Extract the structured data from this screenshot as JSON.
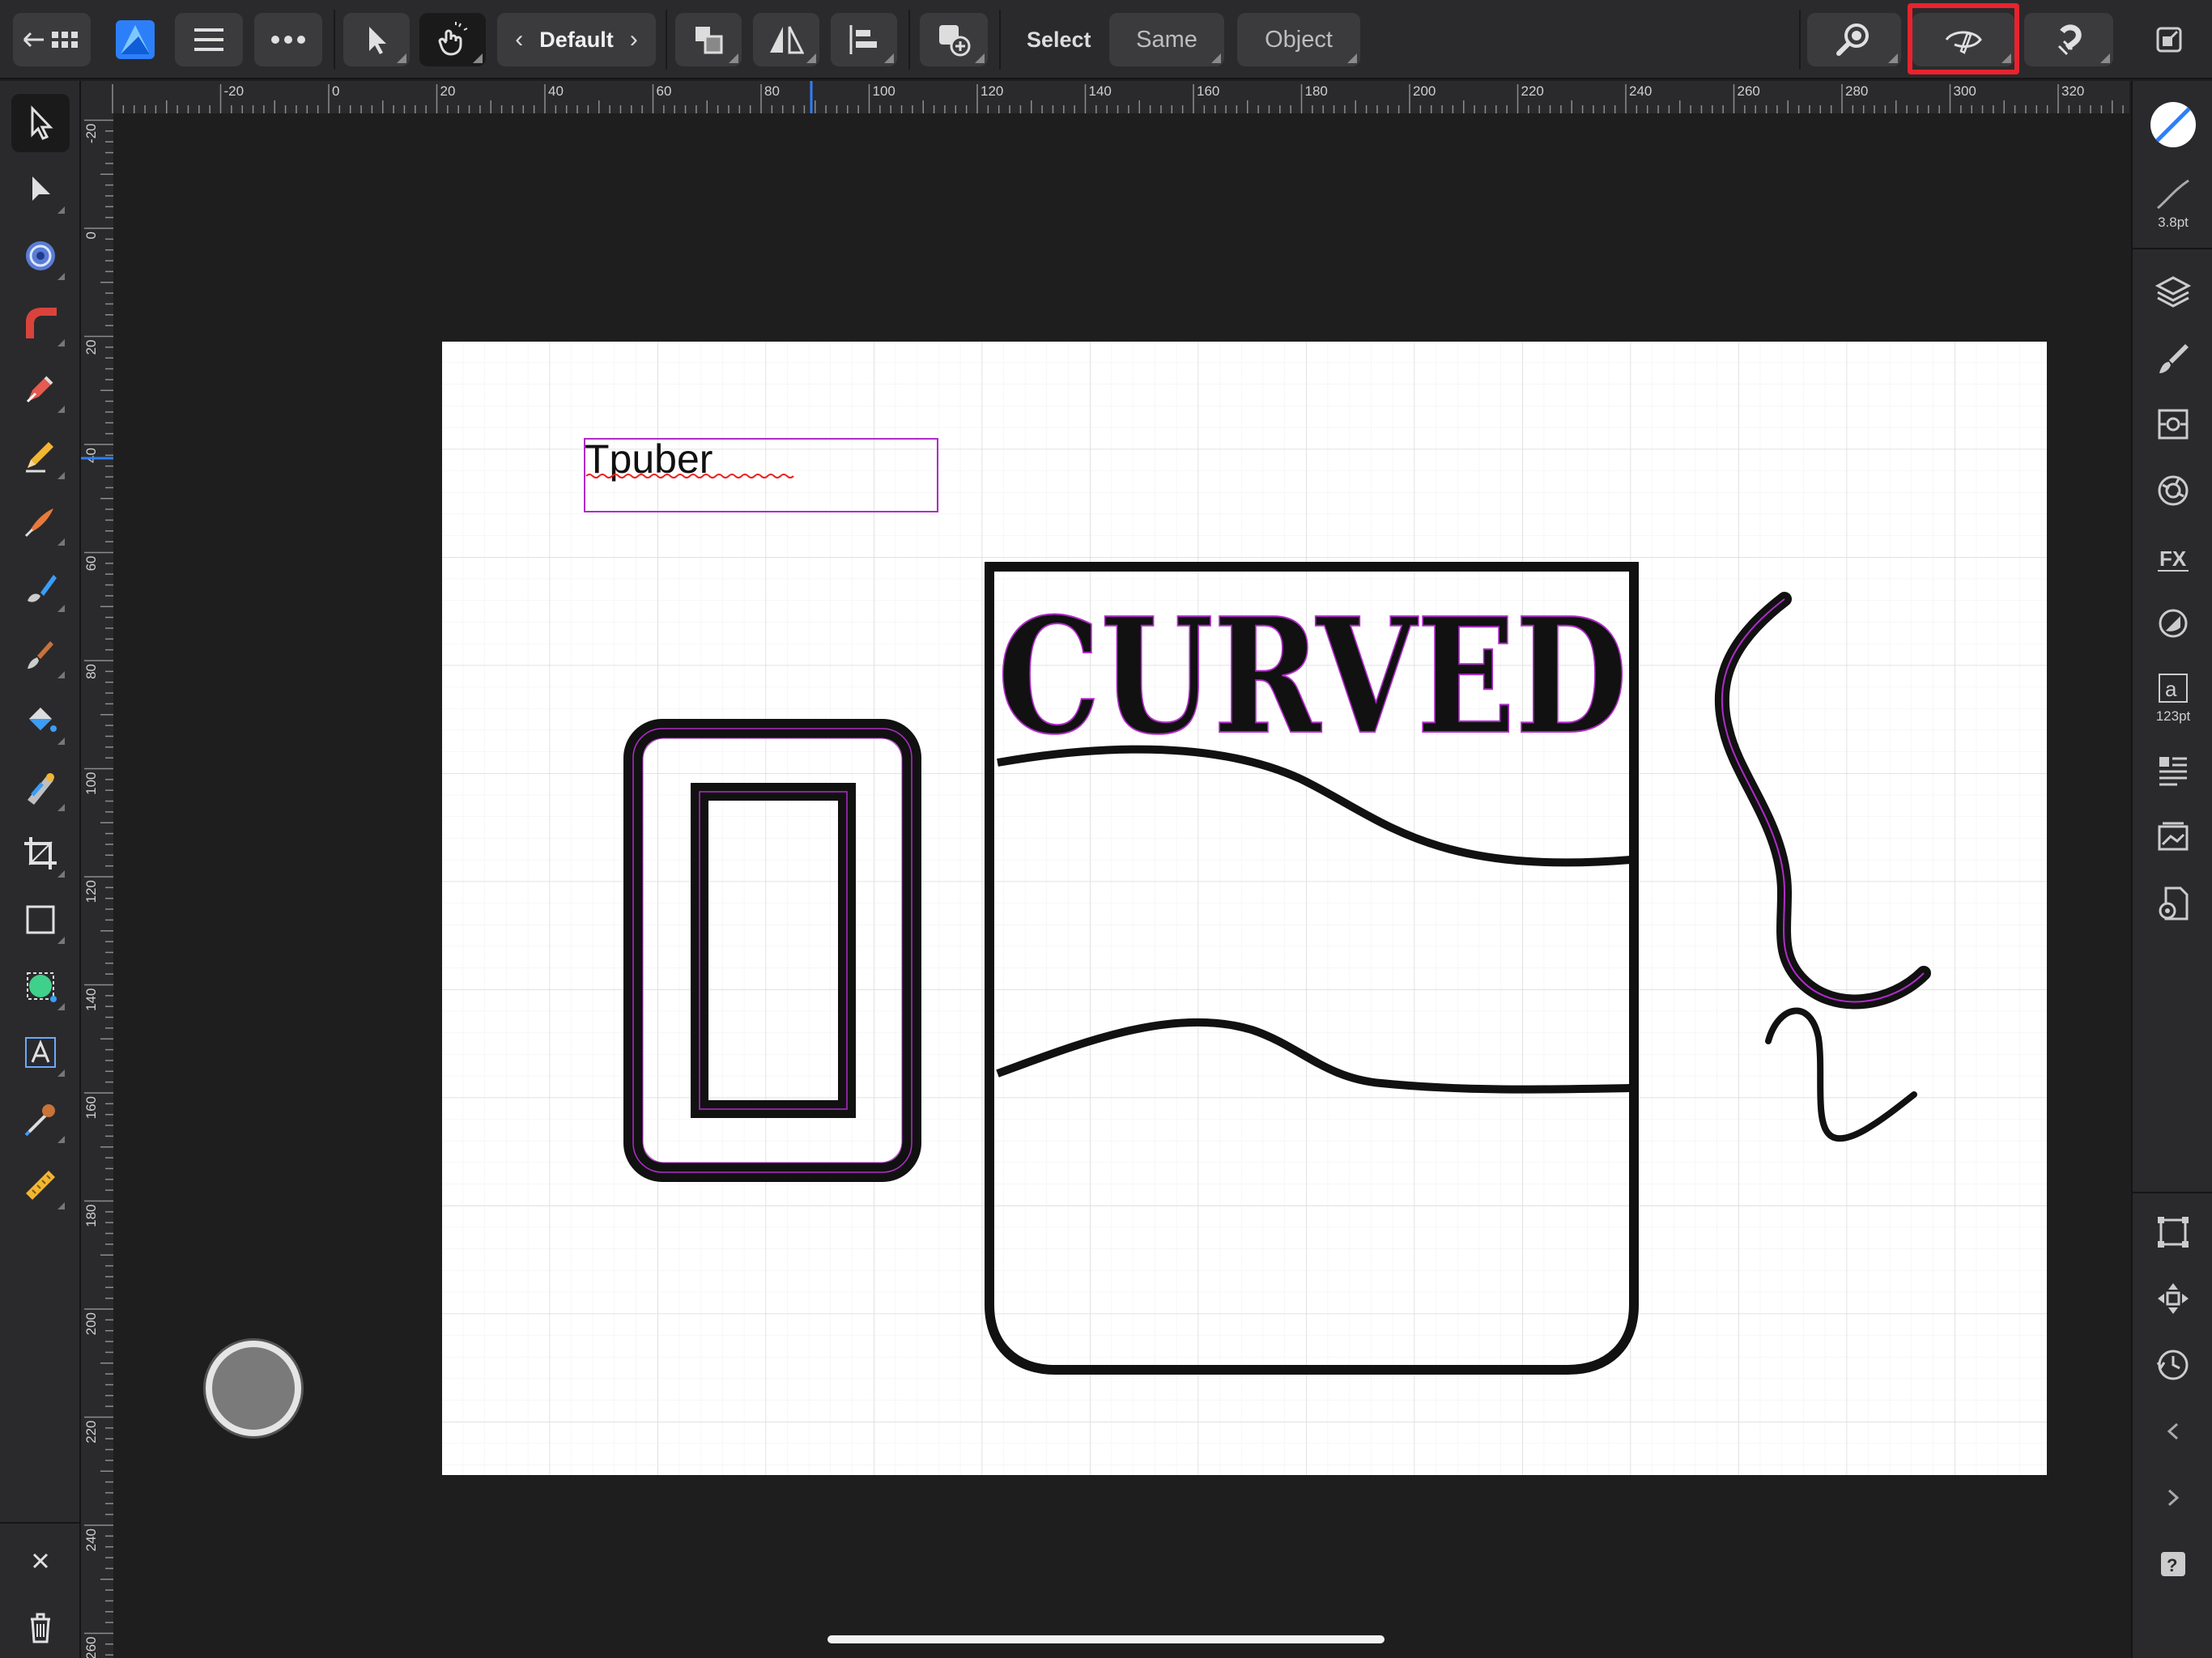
{
  "toolbar": {
    "persona_name": "Default",
    "select_label": "Select",
    "same_label": "Same",
    "object_label": "Object"
  },
  "ruler": {
    "unit": "mm",
    "h_ticks": [
      "-20",
      "0",
      "20",
      "40",
      "60",
      "80",
      "100",
      "120",
      "140",
      "160",
      "180",
      "200",
      "220",
      "240",
      "260",
      "280",
      "300",
      "320"
    ],
    "v_ticks": [
      "-20",
      "0",
      "20",
      "40",
      "60",
      "80",
      "100",
      "120",
      "140",
      "160",
      "180",
      "200",
      "220",
      "240",
      "260"
    ]
  },
  "right_panel": {
    "stroke_width": "3.8pt",
    "text_size": "123pt"
  },
  "canvas": {
    "text_frame_content": "Tpuber",
    "curved_text": "CURVED"
  },
  "colors": {
    "accent": "#2d7ff9",
    "selection": "#b02cc9",
    "highlight": "#e8232e"
  }
}
